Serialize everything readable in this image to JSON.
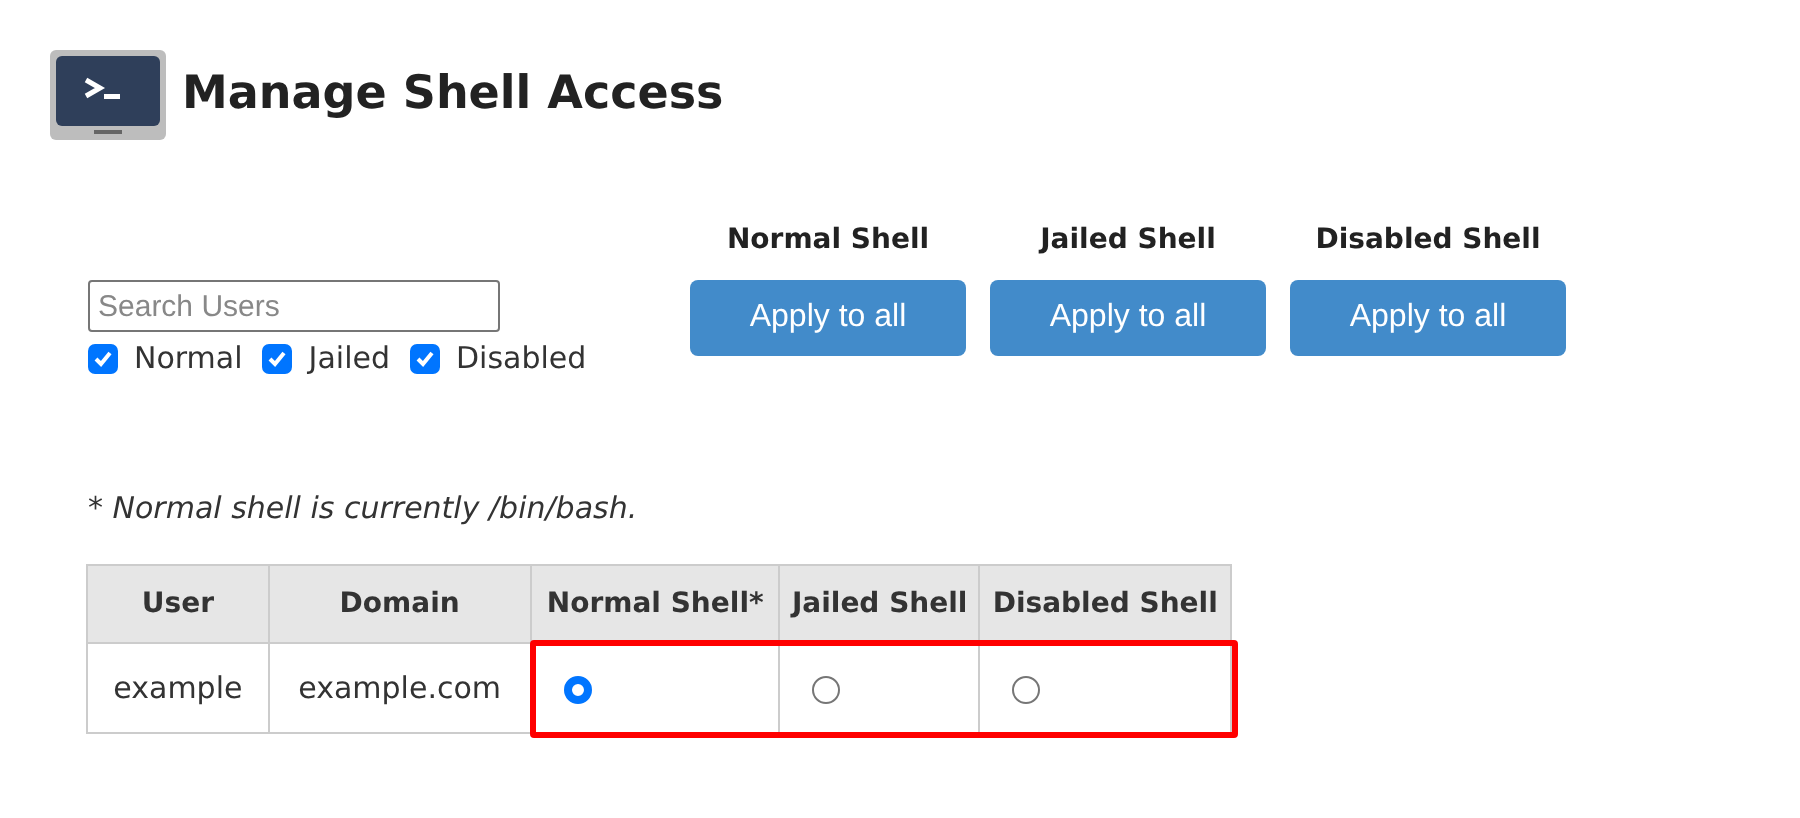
{
  "title": "Manage Shell Access",
  "search": {
    "placeholder": "Search Users"
  },
  "filters": [
    {
      "label": "Normal",
      "checked": true
    },
    {
      "label": "Jailed",
      "checked": true
    },
    {
      "label": "Disabled",
      "checked": true
    }
  ],
  "shell_columns": [
    {
      "heading": "Normal Shell",
      "button": "Apply to all"
    },
    {
      "heading": "Jailed Shell",
      "button": "Apply to all"
    },
    {
      "heading": "Disabled Shell",
      "button": "Apply to all"
    }
  ],
  "note": "* Normal shell is currently /bin/bash.",
  "table": {
    "columns": [
      "User",
      "Domain",
      "Normal Shell*",
      "Jailed Shell",
      "Disabled Shell"
    ],
    "rows": [
      {
        "user": "example",
        "domain": "example.com",
        "highlighted": true,
        "choices": [
          {
            "selected": true
          },
          {
            "selected": false
          },
          {
            "selected": false
          }
        ]
      }
    ]
  }
}
